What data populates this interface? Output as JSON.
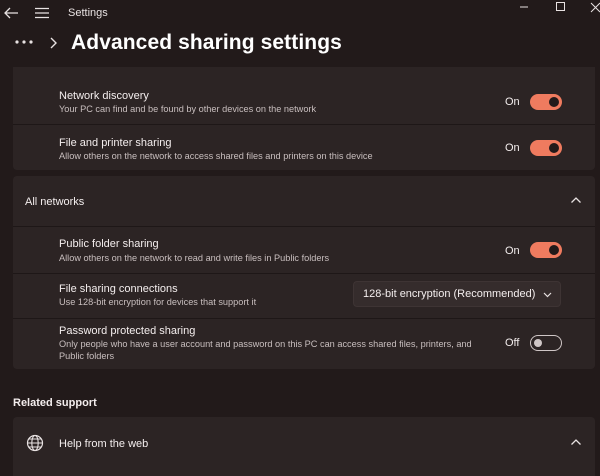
{
  "window": {
    "title": "Settings"
  },
  "header": {
    "title": "Advanced sharing settings"
  },
  "rows": {
    "network_discovery": {
      "title": "Network discovery",
      "desc": "Your PC can find and be found by other devices on the network",
      "state": "On",
      "value": true
    },
    "file_printer": {
      "title": "File and printer sharing",
      "desc": "Allow others on the network to access shared files and printers on this device",
      "state": "On",
      "value": true
    }
  },
  "all_networks": {
    "label": "All networks",
    "public_folder": {
      "title": "Public folder sharing",
      "desc": "Allow others on the network to read and write files in Public folders",
      "state": "On",
      "value": true
    },
    "file_sharing_connections": {
      "title": "File sharing connections",
      "desc": "Use 128-bit encryption for devices that support it",
      "selected": "128-bit encryption (Recommended)"
    },
    "password_protected": {
      "title": "Password protected sharing",
      "desc_line1": "Only people who have a user account and password on this PC can access shared files, printers, and",
      "desc_line2": "Public folders",
      "state": "Off",
      "value": false
    }
  },
  "related_support": {
    "title": "Related support",
    "help_web": "Help from the web"
  },
  "colors": {
    "background": "#221a1a",
    "card": "#2c2424",
    "accent": "#ef7b5f"
  }
}
